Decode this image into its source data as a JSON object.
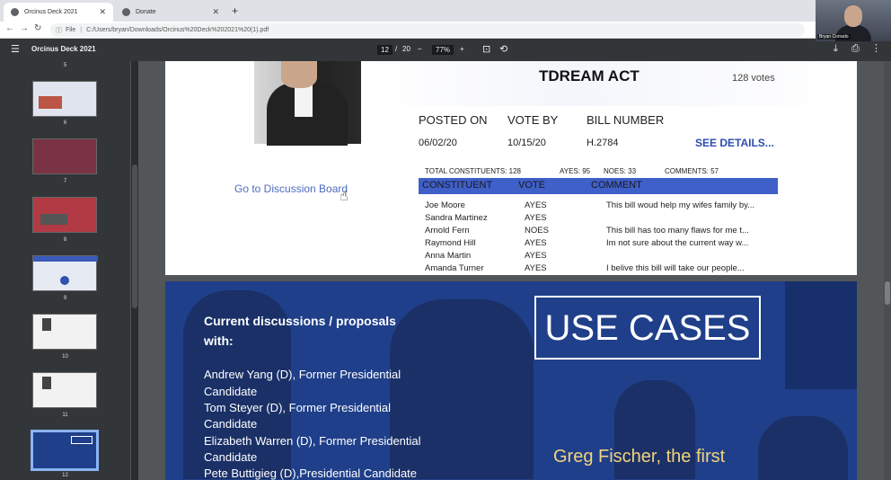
{
  "browser": {
    "tabs": [
      {
        "label": "Orcinus Deck 2021",
        "active": true
      },
      {
        "label": "Donate",
        "active": false
      }
    ],
    "address": {
      "scheme": "File",
      "url": "C:/Users/bryan/Downloads/Orcinus%20Deck%202021%20(1).pdf"
    }
  },
  "webcam": {
    "name": "Bryan Corrado"
  },
  "pdf_toolbar": {
    "title": "Orcinus Deck 2021",
    "page_current": "12",
    "page_sep": "/",
    "page_total": "20",
    "zoom_minus": "−",
    "zoom": "77%",
    "zoom_plus": "+"
  },
  "sidebar": {
    "numbers": [
      "5",
      "6",
      "7",
      "8",
      "9",
      "10",
      "11",
      "12"
    ]
  },
  "page12": {
    "bill_title": "TDREAM ACT",
    "votes": "128 votes",
    "posted_on_label": "POSTED ON",
    "posted_on": "06/02/20",
    "vote_by_label": "VOTE BY",
    "vote_by": "10/15/20",
    "bill_number_label": "BILL NUMBER",
    "bill_number": "H.2784",
    "see_details": "SEE DETAILS...",
    "discussion_link": "Go to Discussion Board",
    "stats": {
      "total": "TOTAL CONSTITUENTS: 128",
      "ayes": "AYES: 95",
      "noes": "NOES: 33",
      "comments": "COMMENTS: 57"
    },
    "table": {
      "headers": [
        "CONSTITUENT",
        "VOTE",
        "COMMENT"
      ],
      "rows": [
        {
          "name": "Joe Moore",
          "vote": "AYES",
          "comment": "This bill woud help my wifes family by..."
        },
        {
          "name": "Sandra Martinez",
          "vote": "AYES",
          "comment": ""
        },
        {
          "name": "Arnold Fern",
          "vote": "NOES",
          "comment": "This bill has too many flaws for me t..."
        },
        {
          "name": "Raymond Hill",
          "vote": "AYES",
          "comment": "Im not sure about the current way w..."
        },
        {
          "name": "Anna Martin",
          "vote": "AYES",
          "comment": ""
        },
        {
          "name": "Amanda Turner",
          "vote": "AYES",
          "comment": "I belive this bill will take our people..."
        }
      ]
    }
  },
  "page13": {
    "heading_line1": "Current discussions / proposals",
    "heading_line2": "with:",
    "discussions": [
      "Andrew Yang (D), Former Presidential",
      "Candidate",
      "Tom Steyer (D), Former Presidential",
      "Candidate",
      "Elizabeth Warren (D), Former Presidential",
      "Candidate",
      "Pete Buttigieg (D),Presidential Candidate"
    ],
    "use_cases": "USE CASES",
    "greg": "Greg Fischer, the first"
  }
}
